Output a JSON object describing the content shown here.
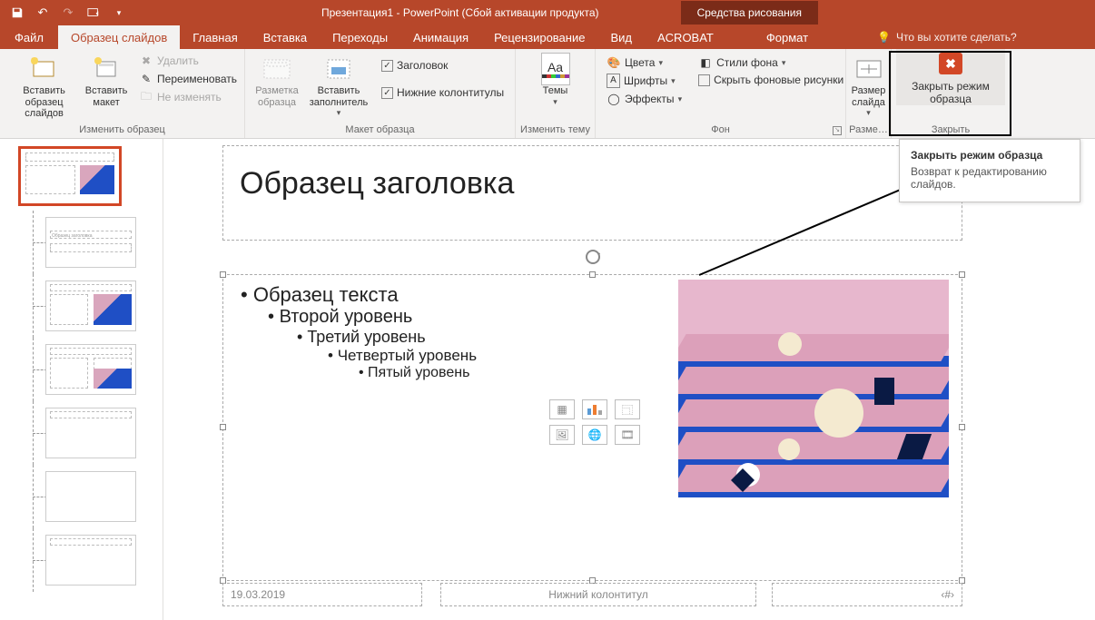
{
  "title": "Презентация1 - PowerPoint (Сбой активации продукта)",
  "context_tab": "Средства рисования",
  "tabs": {
    "file": "Файл",
    "master": "Образец слайдов",
    "home": "Главная",
    "insert": "Вставка",
    "transitions": "Переходы",
    "animations": "Анимация",
    "review": "Рецензирование",
    "view": "Вид",
    "acrobat": "ACROBAT",
    "format": "Формат"
  },
  "tellme": "Что вы хотите сделать?",
  "ribbon": {
    "edit_master": {
      "insert_slide_master": "Вставить образец слайдов",
      "insert_layout": "Вставить макет",
      "delete": "Удалить",
      "rename": "Переименовать",
      "preserve": "Не изменять",
      "group": "Изменить образец"
    },
    "master_layout": {
      "master_layout": "Разметка образца",
      "insert_placeholder": "Вставить заполнитель",
      "title_cb": "Заголовок",
      "footers_cb": "Нижние колонтитулы",
      "group": "Макет образца"
    },
    "edit_theme": {
      "themes": "Темы",
      "group": "Изменить тему"
    },
    "background": {
      "colors": "Цвета",
      "fonts": "Шрифты",
      "effects": "Эффекты",
      "bg_styles": "Стили фона",
      "hide_bg": "Скрыть фоновые рисунки",
      "group": "Фон"
    },
    "size": {
      "slide_size": "Размер слайда",
      "group": "Разме…"
    },
    "close": {
      "close_master": "Закрыть режим образца",
      "group": "Закрыть"
    }
  },
  "tooltip": {
    "title": "Закрыть режим образца",
    "body": "Возврат к редактированию слайдов."
  },
  "slide": {
    "title": "Образец заголовка",
    "lvl1": "Образец текста",
    "lvl2": "Второй уровень",
    "lvl3": "Третий уровень",
    "lvl4": "Четвертый уровень",
    "lvl5": "Пятый уровень",
    "date": "19.03.2019",
    "footer": "Нижний колонтитул",
    "num": "‹#›"
  },
  "thumb_text": "Образец заголовка"
}
